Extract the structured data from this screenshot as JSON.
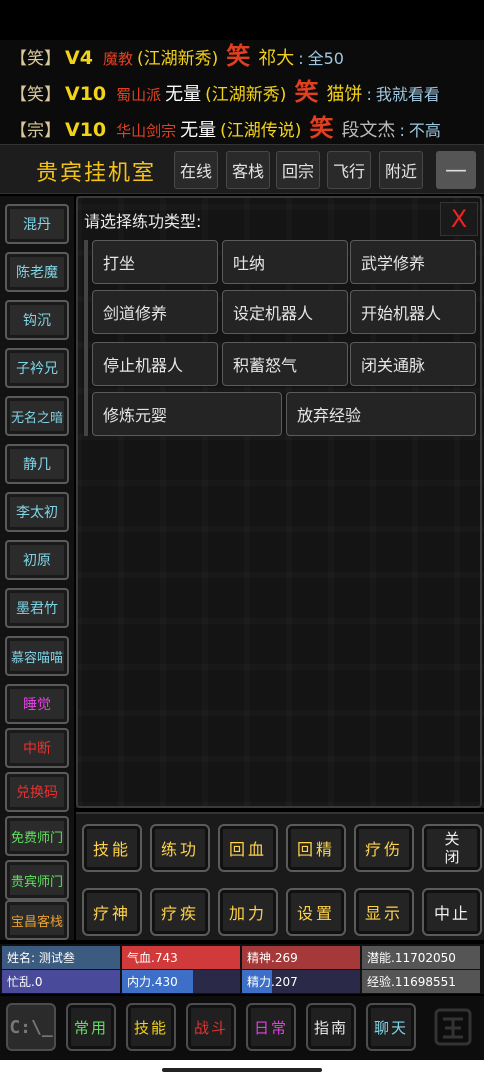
{
  "chat": [
    {
      "channel": "【笑】",
      "vip": "V4",
      "sect": "魔教",
      "sect_color": "#e04020",
      "title": "",
      "rank": "(江湖新秀)",
      "emote": "笑",
      "user": "祁大",
      "user_color": "#f3d21a",
      "message": "全50"
    },
    {
      "channel": "【笑】",
      "vip": "V10",
      "sect": "蜀山派",
      "sect_color": "#e04020",
      "title": "无量",
      "rank": "(江湖新秀)",
      "emote": "笑",
      "user": "猫饼",
      "user_color": "#f3d21a",
      "message": "我就看看"
    },
    {
      "channel": "【宗】",
      "vip": "V10",
      "sect": "华山剑宗",
      "sect_color": "#e04020",
      "title": "无量",
      "rank": "(江湖传说)",
      "emote": "笑",
      "user": "段文杰",
      "user_color": "#bbbbbb",
      "message": "不高"
    }
  ],
  "topbar": {
    "title": "贵宾挂机室",
    "buttons": [
      "在线",
      "客栈",
      "回宗",
      "飞行",
      "附近"
    ],
    "menu_icon": "minus-icon"
  },
  "sidebar": [
    {
      "label": "混丹",
      "color": "#7fd4e6"
    },
    {
      "label": "陈老魔",
      "color": "#7fd4e6"
    },
    {
      "label": "钩沉",
      "color": "#7fd4e6"
    },
    {
      "label": "子衿兄",
      "color": "#7fd4e6"
    },
    {
      "label": "无名之暗",
      "color": "#7fd4e6"
    },
    {
      "label": "静几",
      "color": "#7fd4e6"
    },
    {
      "label": "李太初",
      "color": "#7fd4e6"
    },
    {
      "label": "初原",
      "color": "#7fd4e6"
    },
    {
      "label": "墨君竹",
      "color": "#7fd4e6"
    },
    {
      "label": "慕容喵喵",
      "color": "#7fd4e6"
    },
    {
      "label": "睡觉",
      "color": "#e040e0"
    },
    {
      "label": "中断",
      "color": "#e83030"
    },
    {
      "label": "兑换码",
      "color": "#e83030"
    },
    {
      "label": "免费师门",
      "color": "#5fe060"
    },
    {
      "label": "贵宾师门",
      "color": "#5fe060"
    },
    {
      "label": "宝昌客栈",
      "color": "#e8a030"
    }
  ],
  "dialog": {
    "prompt": "请选择练功类型:",
    "close_label": "X",
    "options": [
      "打坐",
      "吐纳",
      "武学修养",
      "剑道修养",
      "设定机器人",
      "开始机器人",
      "停止机器人",
      "积蓄怒气",
      "闭关通脉",
      "修炼元婴",
      "放弃经验"
    ]
  },
  "actions": {
    "row1": [
      "技能",
      "练功",
      "回血",
      "回精",
      "疗伤"
    ],
    "close_top": "关",
    "close_bottom": "闭",
    "row2": [
      "疗神",
      "疗疾",
      "加力",
      "设置",
      "显示",
      "中止"
    ]
  },
  "stats": {
    "name": "姓名: 测试叁",
    "qixue": "气血.743",
    "jingshen": "精神.269",
    "qianneng": "潜能.11702050",
    "mangluan": "忙乱.0",
    "neili": "内力.430",
    "jingli": "精力.207",
    "jingyan": "经验.11698551",
    "neili_fill": 0.6,
    "jingli_fill": 0.25
  },
  "bottomnav": {
    "cmd_icon": "command-prompt-icon",
    "items": [
      {
        "label": "常用",
        "color": "#5fe060"
      },
      {
        "label": "技能",
        "color": "#f3d21a"
      },
      {
        "label": "战斗",
        "color": "#e83030"
      },
      {
        "label": "日常",
        "color": "#e040e0"
      },
      {
        "label": "指南",
        "color": "#e8e8e8"
      },
      {
        "label": "聊天",
        "color": "#7fd4e6"
      }
    ],
    "logo_icon": "game-logo-icon"
  }
}
